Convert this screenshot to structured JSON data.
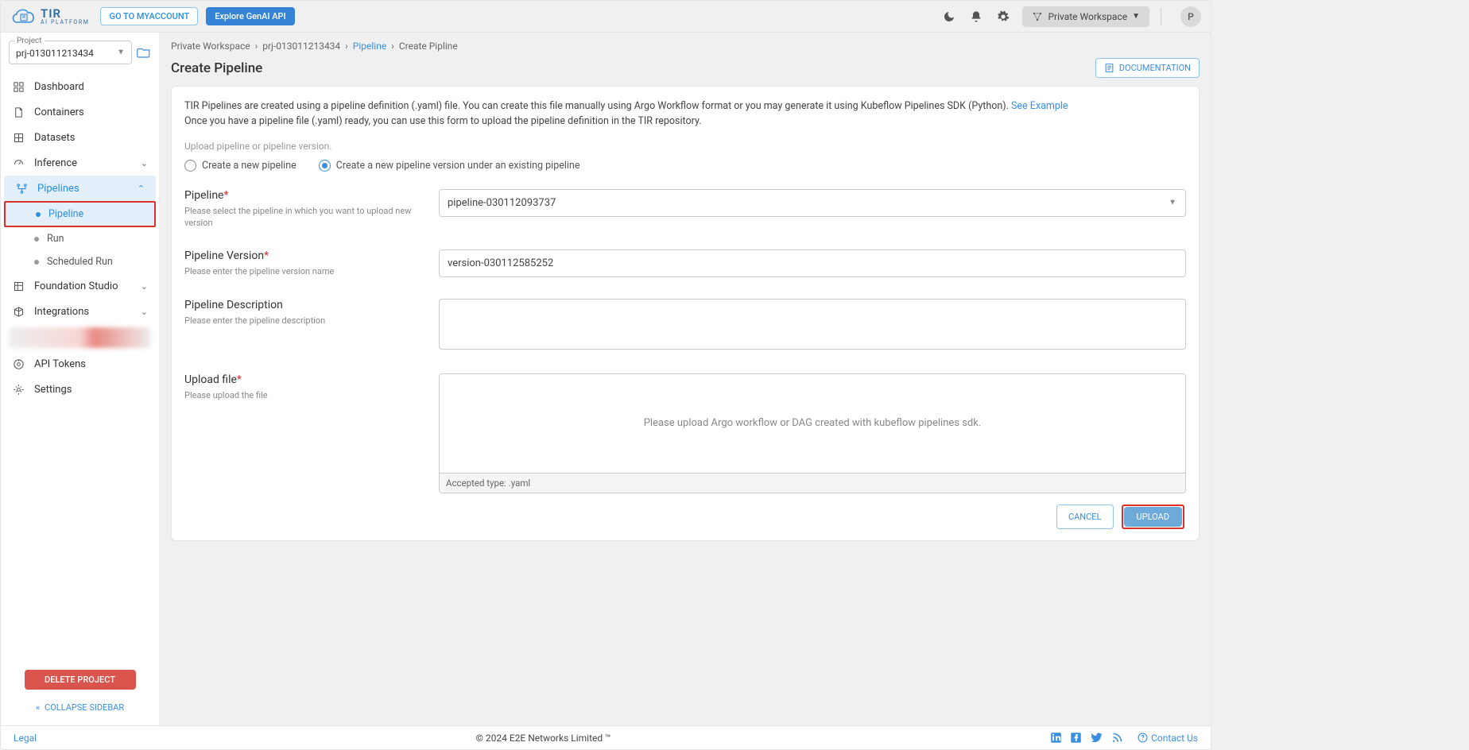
{
  "topbar": {
    "logo_brand": "TIR",
    "logo_sub": "AI PLATFORM",
    "go_myaccount": "GO TO MYACCOUNT",
    "explore_api": "Explore GenAI API",
    "workspace_label": "Private Workspace",
    "avatar_initial": "P"
  },
  "sidebar": {
    "project_label": "Project",
    "project_value": "prj-013011213434",
    "items": {
      "dashboard": "Dashboard",
      "containers": "Containers",
      "datasets": "Datasets",
      "inference": "Inference",
      "pipelines": "Pipelines",
      "pipeline": "Pipeline",
      "run": "Run",
      "scheduled_run": "Scheduled Run",
      "foundation": "Foundation Studio",
      "integrations": "Integrations",
      "api_tokens": "API Tokens",
      "settings": "Settings"
    },
    "delete_project": "DELETE PROJECT",
    "collapse": "COLLAPSE SIDEBAR"
  },
  "breadcrumb": {
    "workspace": "Private Workspace",
    "project": "prj-013011213434",
    "pipeline": "Pipeline",
    "create": "Create Pipline"
  },
  "page": {
    "title": "Create Pipeline",
    "doc_btn": "DOCUMENTATION",
    "intro_1": "TIR Pipelines are created using a pipeline definition (.yaml) file. You can create this file manually using Argo Workflow format or you may generate it using Kubeflow Pipelines SDK (Python). ",
    "intro_link": "See Example",
    "intro_2": "Once you have a pipeline file (.yaml) ready, you can use this form to upload the pipeline definition in the TIR repository.",
    "upload_hint": "Upload pipeline or pipeline version.",
    "radio_new": "Create a new pipeline",
    "radio_existing": "Create a new pipeline version under an existing pipeline"
  },
  "form": {
    "pipeline": {
      "label": "Pipeline",
      "help": "Please select the pipeline in which you want to upload new version",
      "value": "pipeline-030112093737"
    },
    "version": {
      "label": "Pipeline Version",
      "help": "Please enter the pipeline version name",
      "value": "version-030112585252"
    },
    "description": {
      "label": "Pipeline Description",
      "help": "Please enter the pipeline description",
      "value": ""
    },
    "upload": {
      "label": "Upload file",
      "help": "Please upload the file",
      "dropzone_text": "Please upload Argo workflow or DAG created with kubeflow pipelines sdk.",
      "accepted": "Accepted type: .yaml"
    }
  },
  "actions": {
    "cancel": "CANCEL",
    "upload": "UPLOAD"
  },
  "footer": {
    "legal": "Legal",
    "copyright": "© 2024 E2E Networks Limited ™",
    "contact": "Contact Us"
  }
}
